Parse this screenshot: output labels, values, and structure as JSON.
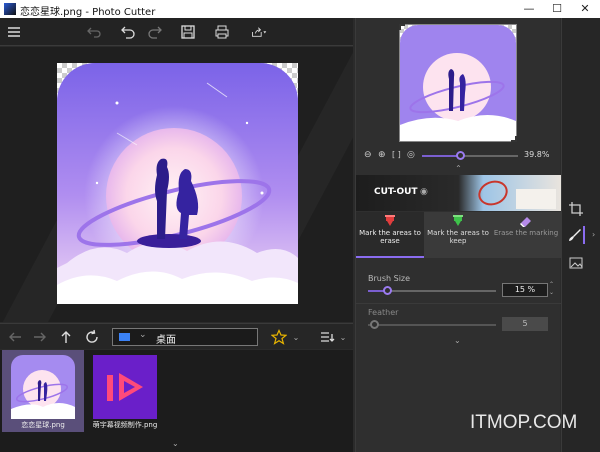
{
  "window": {
    "title": "恋恋星球.png - Photo Cutter",
    "minimize": "—",
    "maximize": "☐",
    "close": "✕"
  },
  "toolbar": {
    "menu_icon": "hamburger-icon",
    "buttons": [
      "undo-all-icon",
      "undo-icon",
      "redo-icon",
      "save-icon",
      "print-icon",
      "share-icon"
    ]
  },
  "navigation": {
    "path": "桌面",
    "buttons": [
      "back-arrow-icon",
      "forward-arrow-icon",
      "up-arrow-icon",
      "refresh-icon",
      "star-icon",
      "sort-icon"
    ]
  },
  "thumbnails": [
    {
      "label": "恋恋星球.png",
      "selected": true
    },
    {
      "label": "萌宇幕视频制作.png",
      "selected": false
    }
  ],
  "zoom": {
    "value": "39.8%",
    "level": 0.398
  },
  "cutout": {
    "label": "CUT-OUT"
  },
  "modes": [
    {
      "label": "Mark the areas to erase",
      "active": true,
      "color": "#e03d3d"
    },
    {
      "label": "Mark the areas to keep",
      "active": false,
      "color": "#3ec24a"
    },
    {
      "label": "Erase the marking",
      "active": false,
      "color": "#b58ae8"
    }
  ],
  "brush_size": {
    "label": "Brush Size",
    "value": "15 %",
    "level": 0.15
  },
  "feather": {
    "label": "Feather",
    "value": "5",
    "level": 0.05
  },
  "side_tools": [
    "crop-icon",
    "brush-icon",
    "image-icon"
  ],
  "watermark": "ITMOP.COM",
  "colors": {
    "accent": "#8a6cf0",
    "background": "#2b2b2b"
  }
}
